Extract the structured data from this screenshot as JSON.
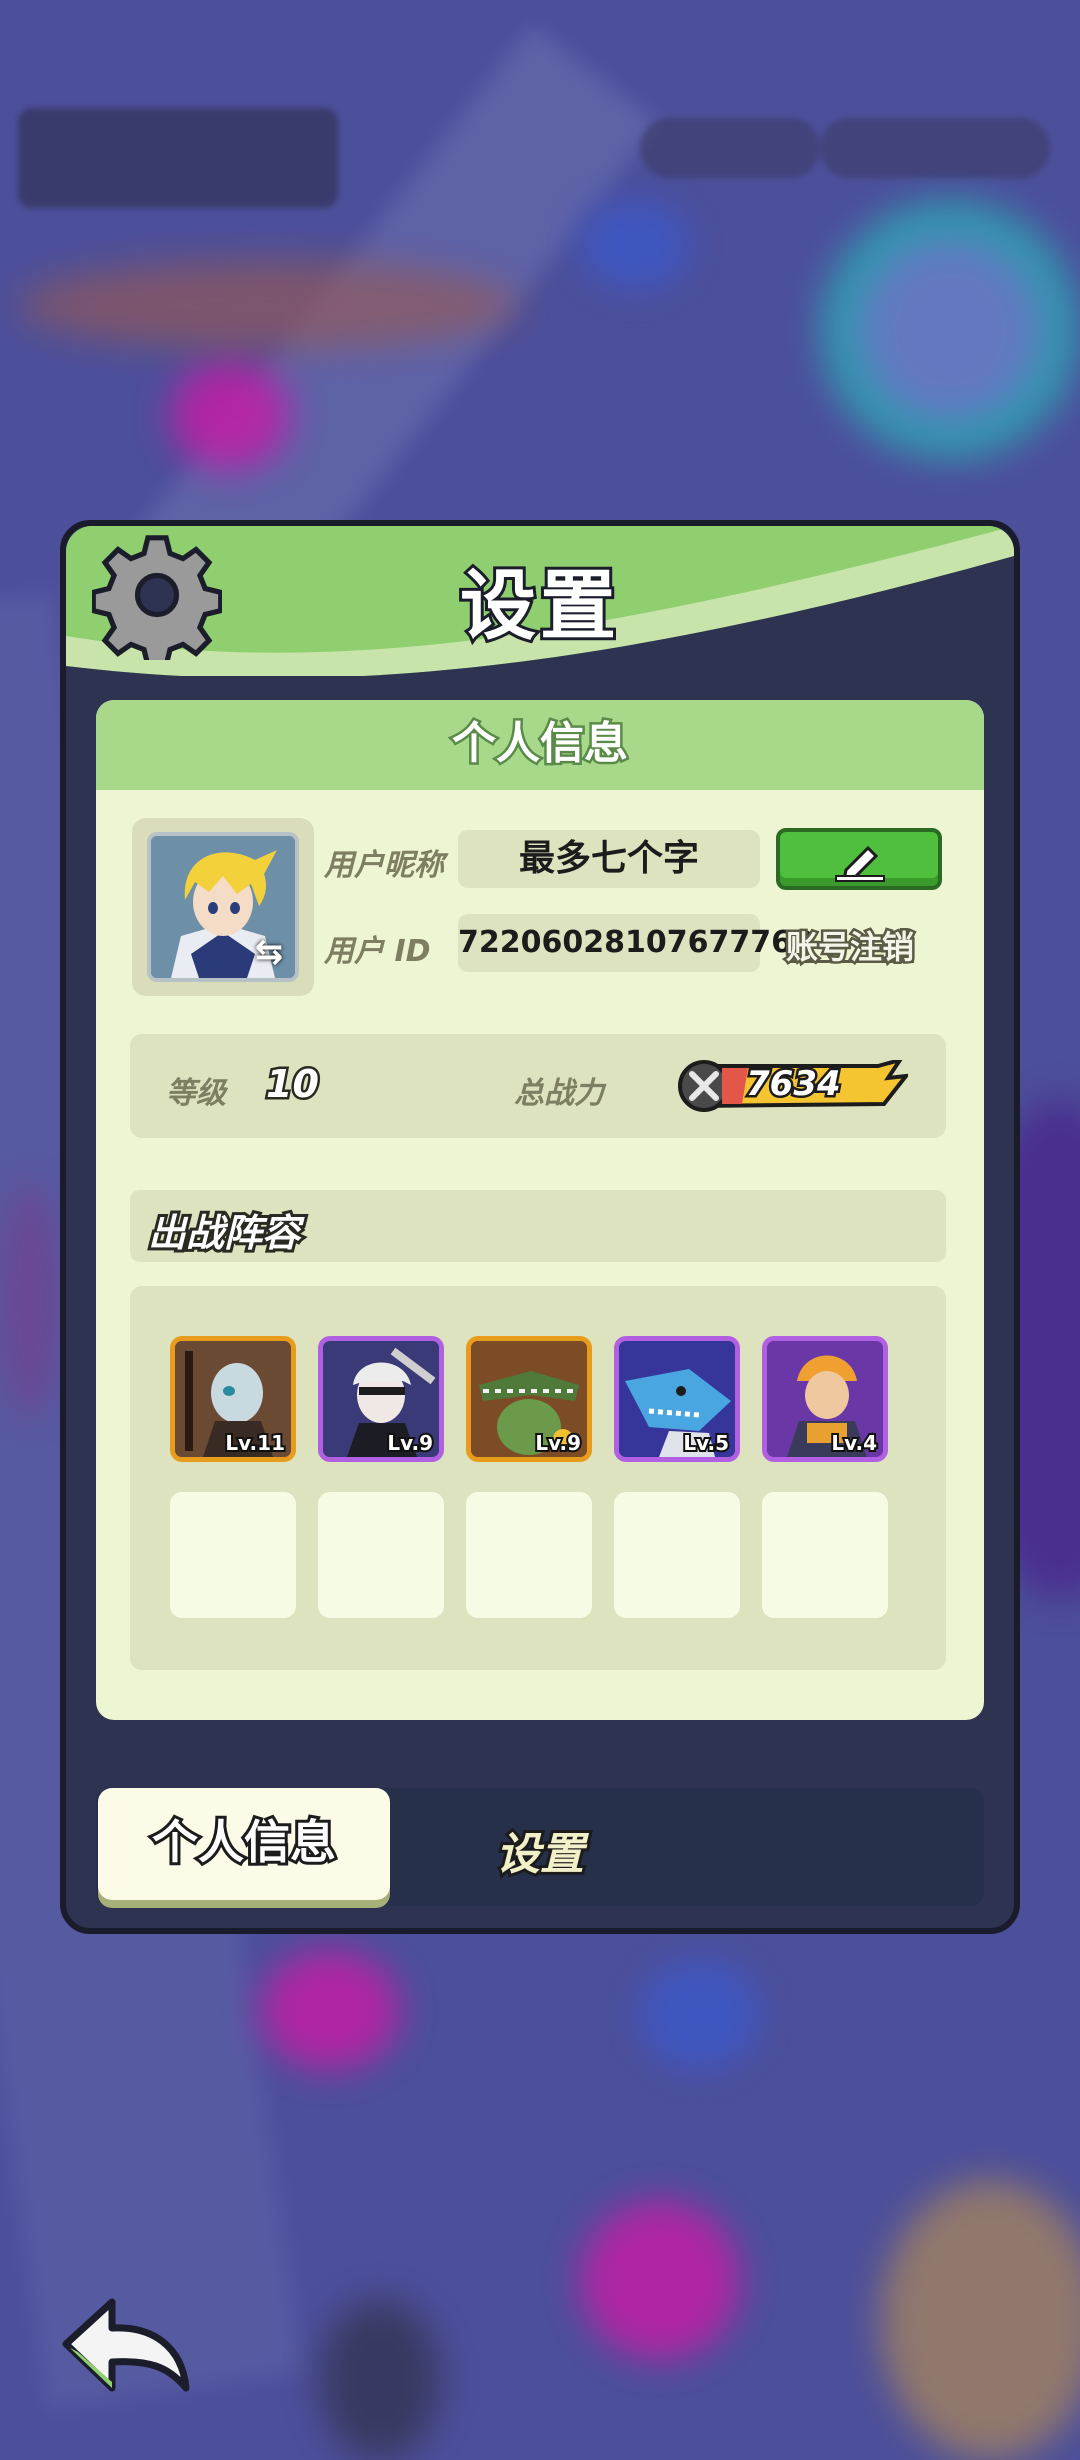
{
  "dialog": {
    "title": "设置",
    "panel_title": "个人信息"
  },
  "profile": {
    "nickname_label": "用户昵称",
    "nickname_value": "最多七个字",
    "id_label": "用户 ID",
    "id_value": "72206028107677768",
    "logout_label": "账号注销"
  },
  "stats": {
    "level_label": "等级",
    "level_value": "10",
    "power_label": "总战力",
    "power_value": "7634"
  },
  "lineup": {
    "title": "出战阵容",
    "heroes": [
      {
        "level": "Lv.11",
        "rarity": "gold"
      },
      {
        "level": "Lv.9",
        "rarity": "purple"
      },
      {
        "level": "Lv.9",
        "rarity": "gold"
      },
      {
        "level": "Lv.5",
        "rarity": "purple"
      },
      {
        "level": "Lv.4",
        "rarity": "purple"
      }
    ],
    "empty_slots": 5
  },
  "tabs": {
    "personal_info": "个人信息",
    "settings": "设置"
  },
  "colors": {
    "header_green": "#8fcf6f",
    "panel_bg": "#eef5d3",
    "edit_green": "#4fbf3d",
    "power_yellow": "#f5c431"
  }
}
